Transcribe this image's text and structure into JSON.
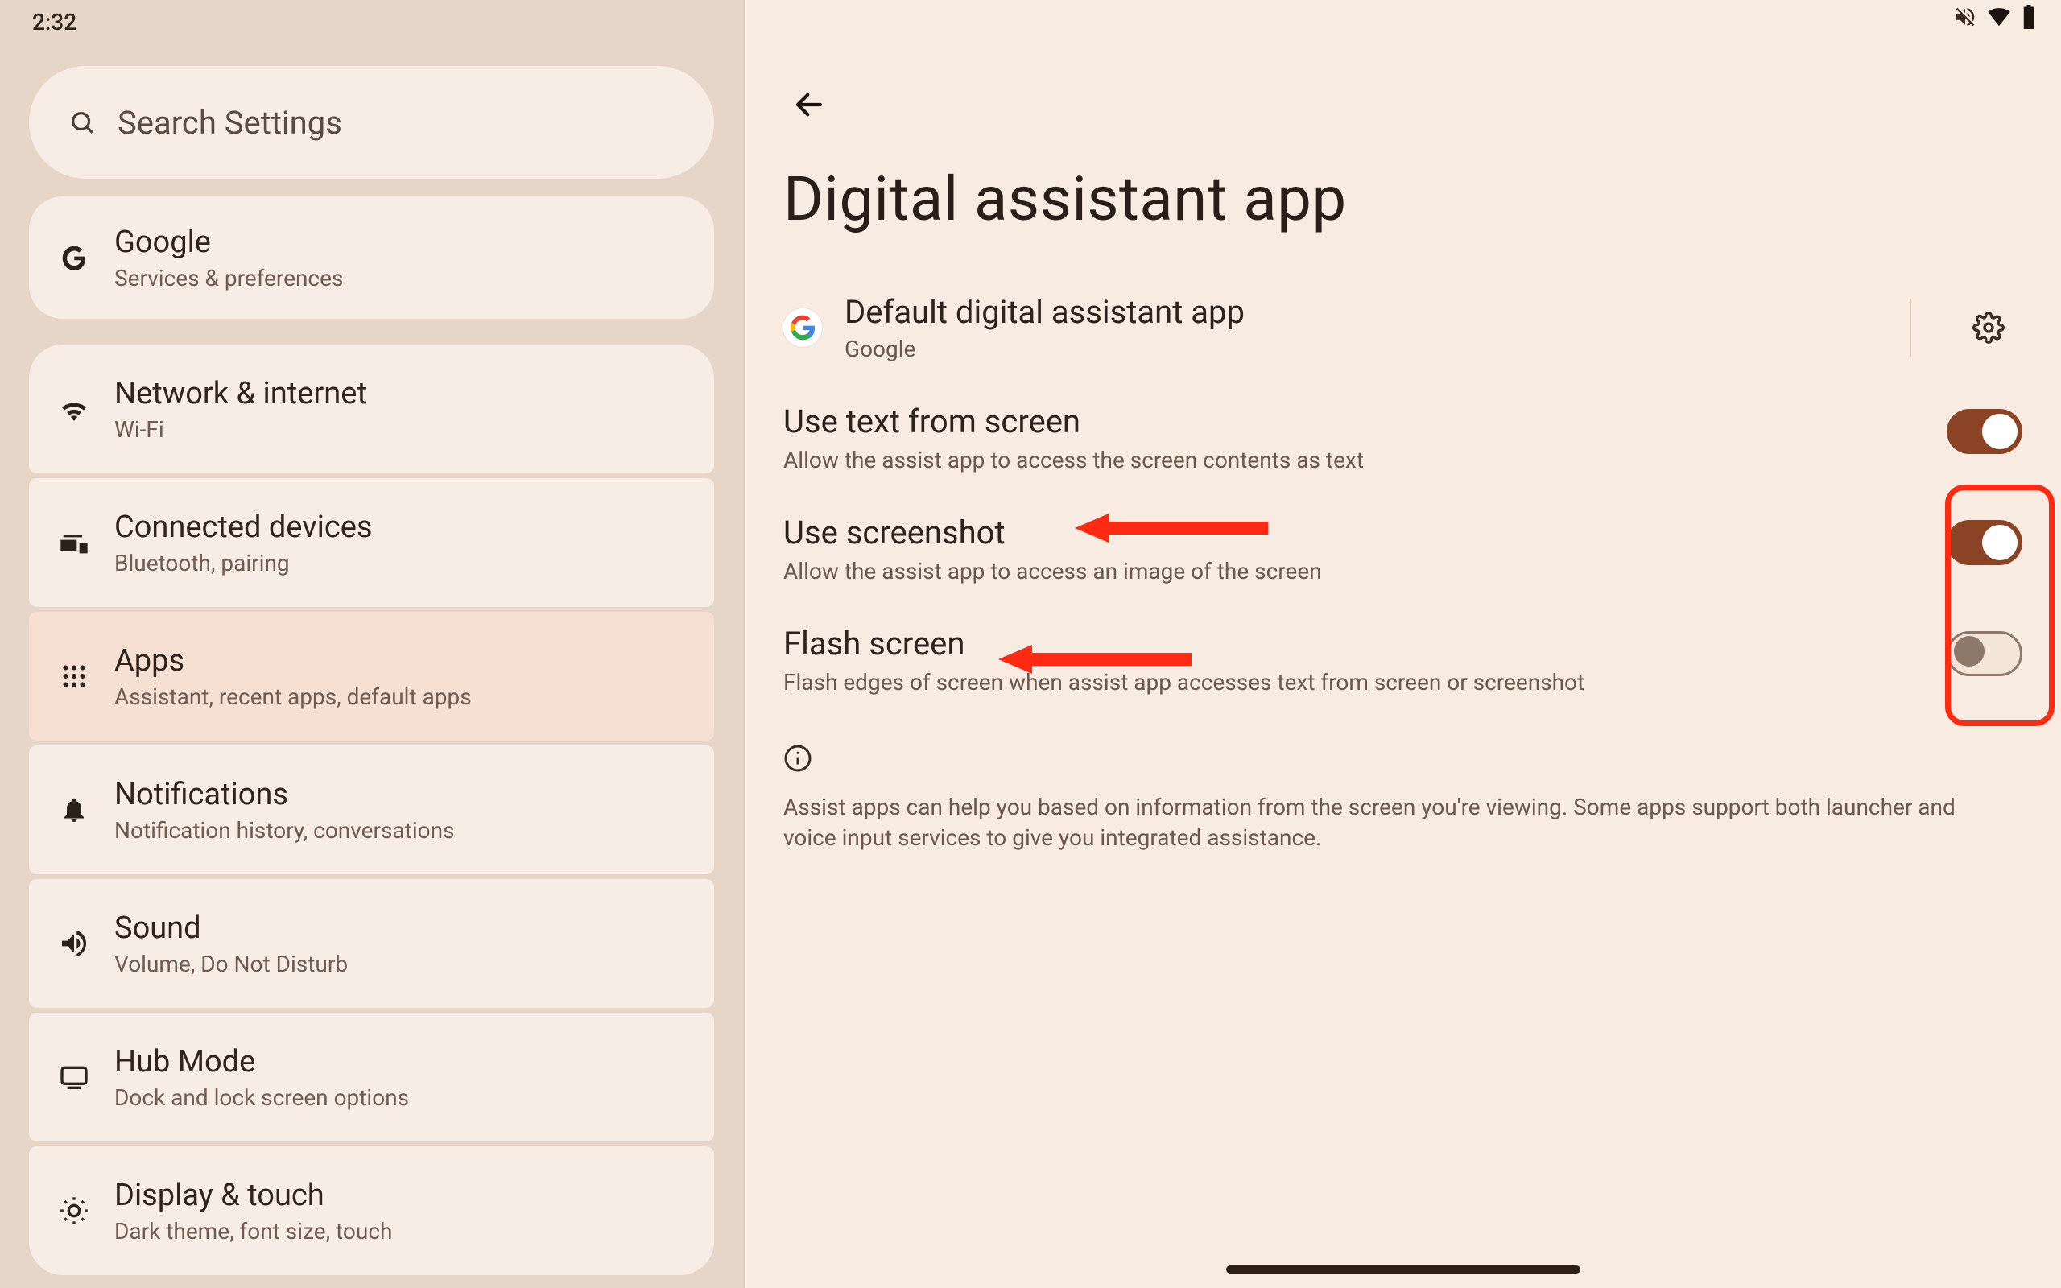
{
  "status": {
    "time": "2:32"
  },
  "search": {
    "placeholder": "Search Settings"
  },
  "sidebar": {
    "google": {
      "title": "Google",
      "sub": "Services & preferences"
    },
    "items": [
      {
        "title": "Network & internet",
        "sub": "Wi-Fi"
      },
      {
        "title": "Connected devices",
        "sub": "Bluetooth, pairing"
      },
      {
        "title": "Apps",
        "sub": "Assistant, recent apps, default apps"
      },
      {
        "title": "Notifications",
        "sub": "Notification history, conversations"
      },
      {
        "title": "Sound",
        "sub": "Volume, Do Not Disturb"
      },
      {
        "title": "Hub Mode",
        "sub": "Dock and lock screen options"
      },
      {
        "title": "Display & touch",
        "sub": "Dark theme, font size, touch"
      }
    ]
  },
  "page": {
    "title": "Digital assistant app",
    "default": {
      "title": "Default digital assistant app",
      "sub": "Google"
    },
    "toggles": [
      {
        "title": "Use text from screen",
        "sub": "Allow the assist app to access the screen contents as text",
        "on": true
      },
      {
        "title": "Use screenshot",
        "sub": "Allow the assist app to access an image of the screen",
        "on": true
      },
      {
        "title": "Flash screen",
        "sub": "Flash edges of screen when assist app accesses text from screen or screenshot",
        "on": false
      }
    ],
    "footer": "Assist apps can help you based on information from the screen you're viewing. Some apps support both launcher and voice input services to give you integrated assistance."
  }
}
